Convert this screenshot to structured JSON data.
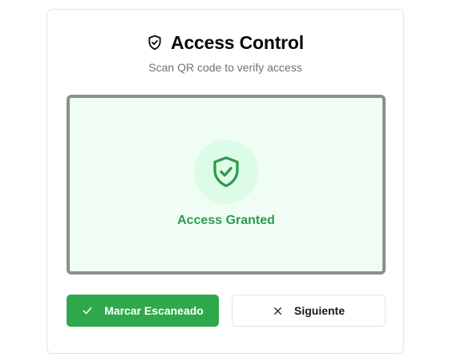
{
  "header": {
    "title": "Access Control",
    "icon": "shield-icon",
    "subtitle": "Scan QR code to verify access"
  },
  "scan": {
    "status_icon": "shield-check-icon",
    "status_text": "Access Granted",
    "colors": {
      "background": "#f0fdf4",
      "circle": "#dcfce7",
      "accent": "#2f9a4d",
      "border": "#8a9189"
    }
  },
  "actions": {
    "primary": {
      "label": "Marcar Escaneado",
      "icon": "check-icon",
      "color": "#2ea84a"
    },
    "secondary": {
      "label": "Siguiente",
      "icon": "x-icon"
    }
  }
}
